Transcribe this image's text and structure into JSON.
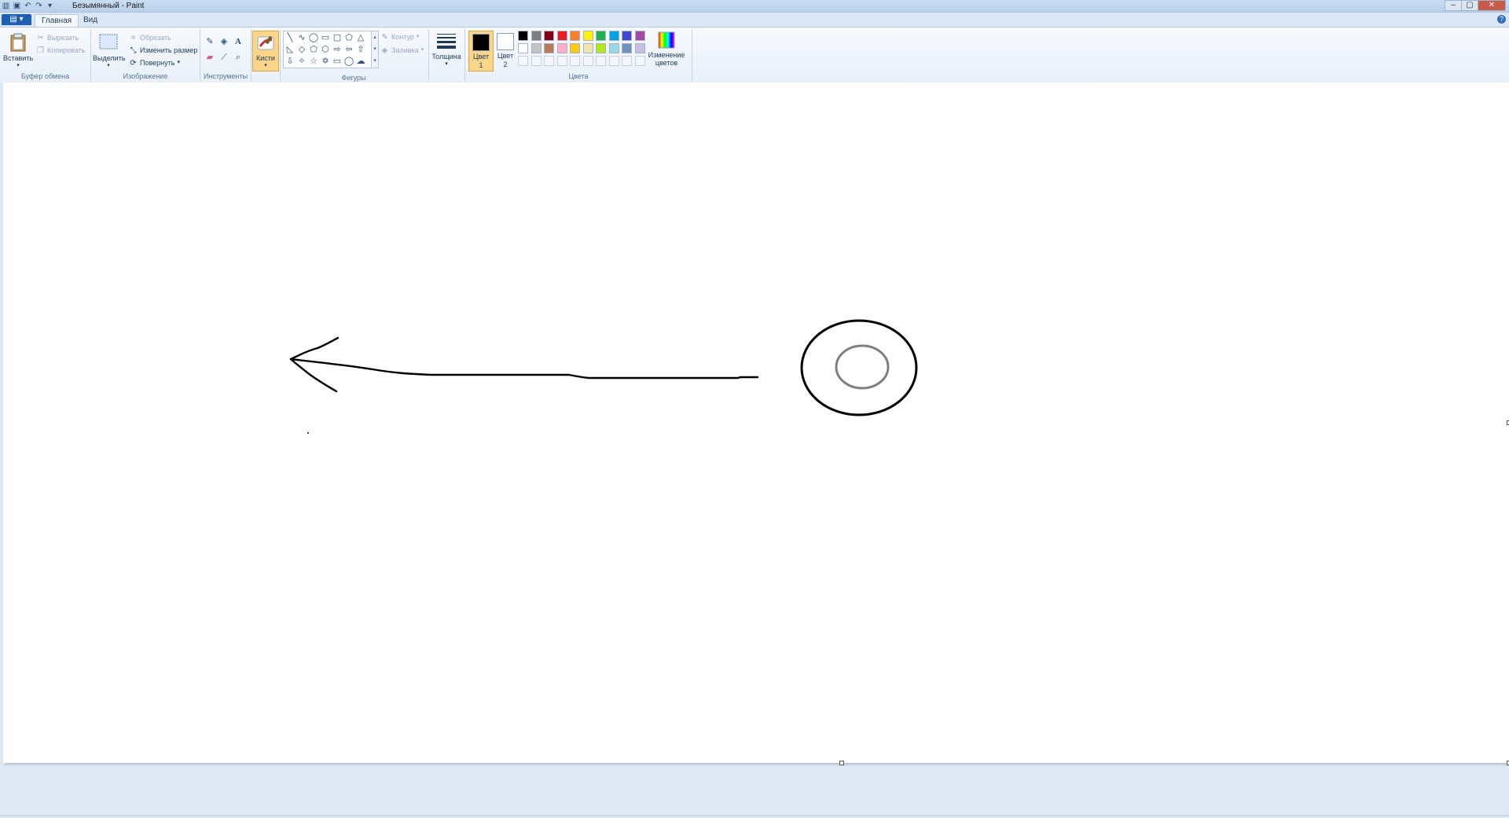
{
  "window": {
    "title": "Безымянный - Paint",
    "controls": [
      "–",
      "▢",
      "✕"
    ]
  },
  "quick_access": [
    "save-icon",
    "undo-icon",
    "redo-icon",
    "customize-icon"
  ],
  "tabs": {
    "file_label": "▤ ▾",
    "items": [
      {
        "label": "Главная",
        "active": true
      },
      {
        "label": "Вид",
        "active": false
      }
    ]
  },
  "ribbon": {
    "clipboard": {
      "group_label": "Буфер обмена",
      "paste": "Вставить",
      "cut": "Вырезать",
      "copy": "Копировать"
    },
    "image": {
      "group_label": "Изображение",
      "select": "Выделить",
      "crop": "Обрезать",
      "resize": "Изменить размер",
      "rotate": "Повернуть"
    },
    "tools": {
      "group_label": "Инструменты",
      "brushes": "Кисти"
    },
    "shapes": {
      "group_label": "Фигуры",
      "outline": "Контур",
      "fill": "Заливка"
    },
    "size": {
      "label": "Толщина"
    },
    "colors": {
      "group_label": "Цвета",
      "color1": "Цвет\n1",
      "color1_line1": "Цвет",
      "color1_line2": "1",
      "color2_line1": "Цвет",
      "color2_line2": "2",
      "edit_line1": "Изменение",
      "edit_line2": "цветов",
      "color1_value": "#000000",
      "color2_value": "#ffffff",
      "palette_row1": [
        "#000000",
        "#7f7f7f",
        "#880015",
        "#ed1c24",
        "#ff7f27",
        "#fff200",
        "#22b14c",
        "#00a2e8",
        "#3f48cc",
        "#a349a4"
      ],
      "palette_row2": [
        "#ffffff",
        "#c3c3c3",
        "#b97a57",
        "#ffaec9",
        "#ffc90e",
        "#efe4b0",
        "#b5e61d",
        "#99d9ea",
        "#7092be",
        "#c8bfe7"
      ]
    }
  },
  "accent": {
    "ribbon_bg": "#f5f9fd",
    "file_tab": "#1f5fb3",
    "selected": "#fbd58a"
  }
}
